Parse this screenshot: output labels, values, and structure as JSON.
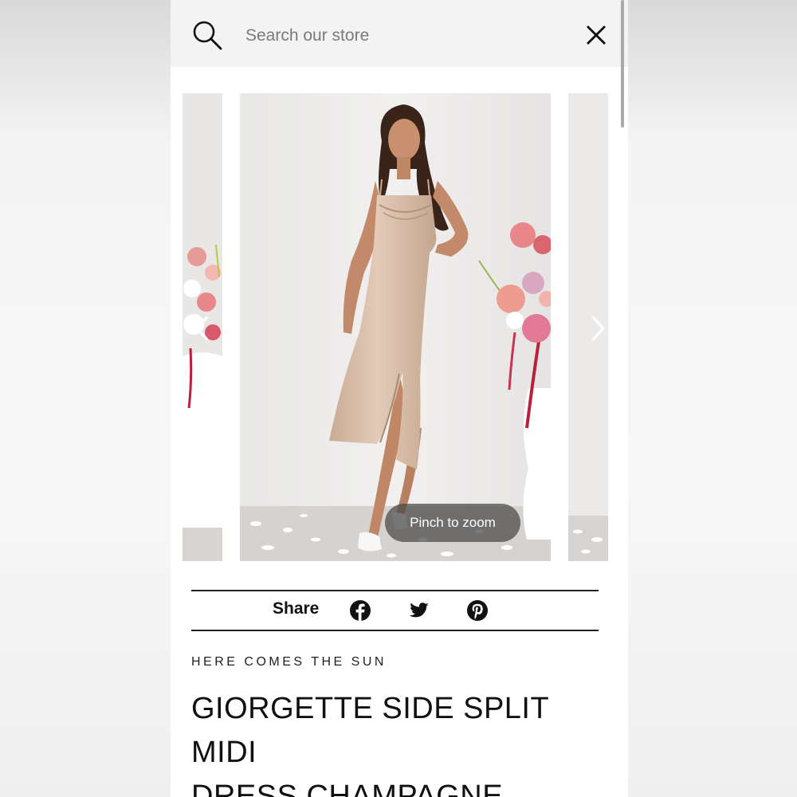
{
  "search": {
    "placeholder": "Search our store",
    "search_icon": "search-icon",
    "close_icon": "close-icon"
  },
  "gallery": {
    "prev_icon": "chevron-left-icon",
    "next_icon": "chevron-right-icon",
    "pinch_label": "Pinch to zoom"
  },
  "share": {
    "label": "Share",
    "icons": [
      "facebook-icon",
      "twitter-icon",
      "pinterest-icon"
    ]
  },
  "product": {
    "brand": "HERE COMES THE SUN",
    "title_line1": "GIORGETTE SIDE SPLIT MIDI",
    "title_line2": "DRESS CHAMPAGNE"
  },
  "colors": {
    "dress": "#d9bea6",
    "background": "#ffffff",
    "search_bar": "#f3f3f3",
    "text": "#111111"
  }
}
